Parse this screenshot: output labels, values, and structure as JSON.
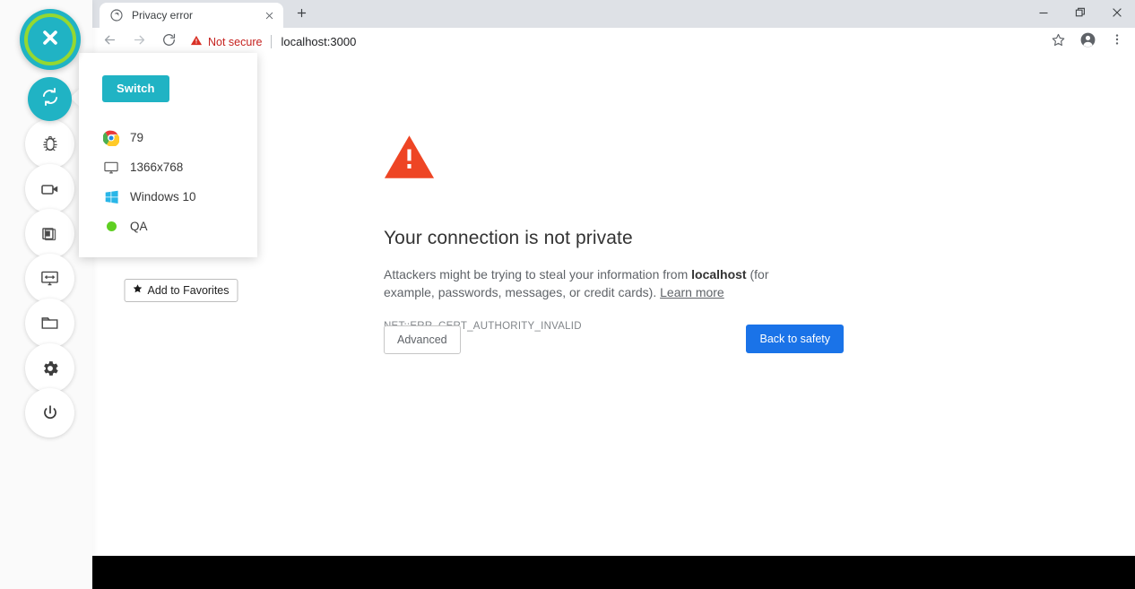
{
  "rail": {
    "close_button": {
      "name": "close-session",
      "icon": "x-icon",
      "bg": "#20b3c4",
      "ring": "#95d831"
    },
    "items": [
      {
        "id": "switch",
        "icon": "sync-icon",
        "active": true
      },
      {
        "id": "bug",
        "icon": "bug-icon",
        "active": false
      },
      {
        "id": "record",
        "icon": "video-icon",
        "active": false
      },
      {
        "id": "layers",
        "icon": "layers-icon",
        "active": false
      },
      {
        "id": "resize",
        "icon": "monitor-resize-icon",
        "active": false
      },
      {
        "id": "files",
        "icon": "folder-icon",
        "active": false
      },
      {
        "id": "settings",
        "icon": "gear-icon",
        "active": false
      },
      {
        "id": "power",
        "icon": "power-icon",
        "active": false
      }
    ]
  },
  "popup": {
    "switch_label": "Switch",
    "rows": [
      {
        "icon": "chrome-icon",
        "label": "79"
      },
      {
        "icon": "monitor-icon",
        "label": "1366x768"
      },
      {
        "icon": "windows-icon",
        "label": "Windows 10"
      },
      {
        "icon": "green-dot-icon",
        "label": "QA"
      }
    ],
    "favorites_label": "Add to Favorites",
    "favorites_icon": "star-icon",
    "accent": "#20b3c4"
  },
  "browser": {
    "tab": {
      "title": "Privacy error",
      "favicon": "globe-icon",
      "close_icon": "close-icon"
    },
    "new_tab_icon": "plus-icon",
    "window_controls": [
      {
        "id": "minimize",
        "icon": "minimize-icon"
      },
      {
        "id": "maximize",
        "icon": "restore-icon"
      },
      {
        "id": "close",
        "icon": "close-icon"
      }
    ],
    "toolbar": {
      "back_icon": "arrow-left-icon",
      "forward_icon": "arrow-right-icon",
      "reload_icon": "reload-icon",
      "security_warning_icon": "warning-triangle-icon",
      "security_label": "Not secure",
      "url": "localhost:3000",
      "bookmark_icon": "star-outline-icon",
      "profile_icon": "account-icon",
      "menu_icon": "more-vertical-icon"
    }
  },
  "page": {
    "warning_icon": "warning-triangle-icon",
    "warning_color": "#ee4524",
    "title": "Your connection is not private",
    "body_before": "Attackers might be trying to steal your information from ",
    "body_host": "localhost",
    "body_after": " (for example, passwords, messages, or credit cards). ",
    "learn_more": "Learn more",
    "error_code": "NET::ERR_CERT_AUTHORITY_INVALID",
    "advanced_label": "Advanced",
    "back_to_safety_label": "Back to safety",
    "primary_color": "#1a73e8"
  }
}
